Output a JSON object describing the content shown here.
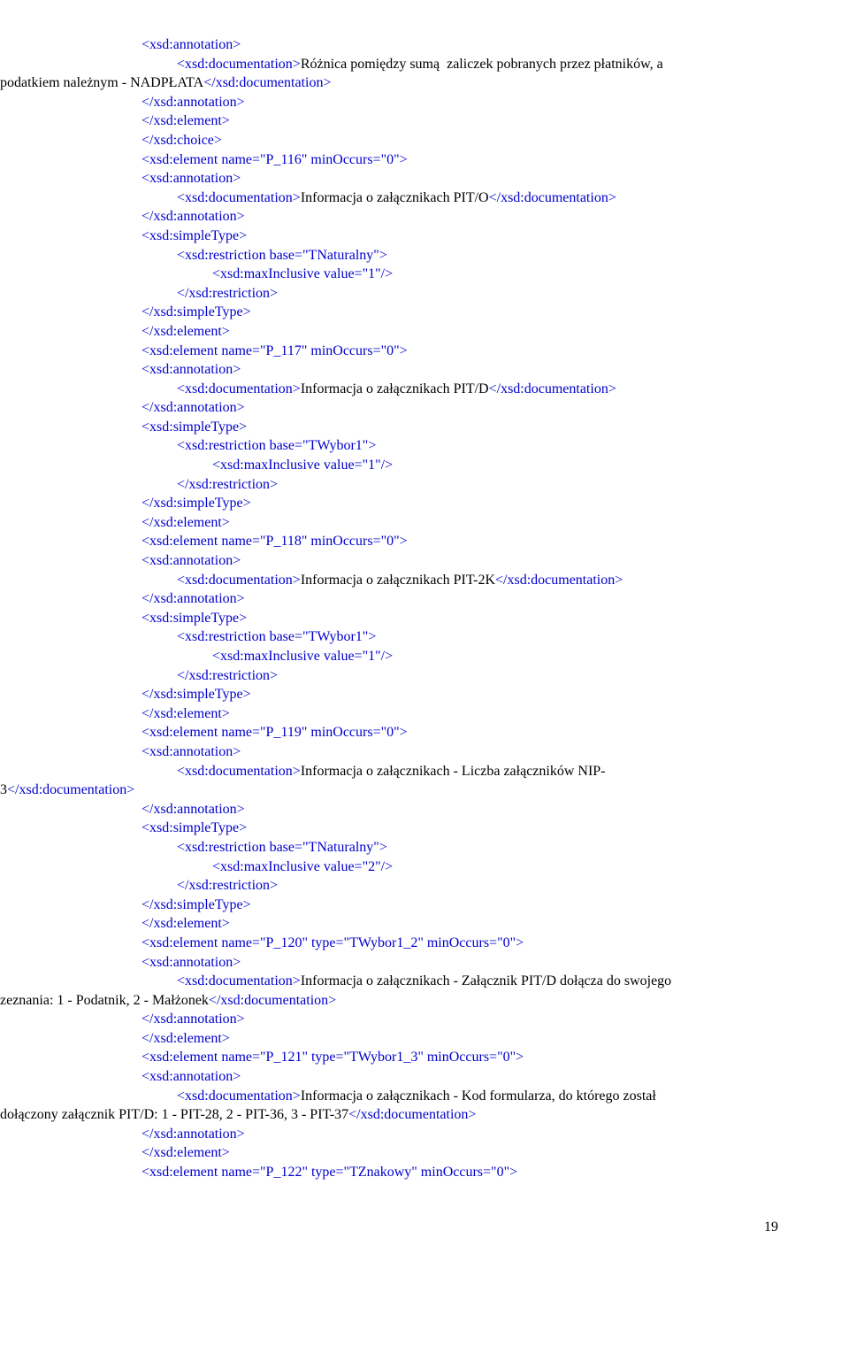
{
  "lines": [
    {
      "indent": "ind1",
      "parts": [
        {
          "c": "ltag",
          "t": "<xsd:annotation>"
        }
      ]
    },
    {
      "indent": "ind2",
      "parts": [
        {
          "c": "ltag",
          "t": "<xsd:documentation>"
        },
        {
          "c": "black",
          "t": "Różnica pomiędzy sumą  zaliczek pobranych przez płatników, a "
        }
      ]
    },
    {
      "indent": "ind0",
      "parts": [
        {
          "c": "black",
          "t": "podatkiem należnym - NADPŁATA"
        },
        {
          "c": "ltag",
          "t": "</xsd:documentation>"
        }
      ]
    },
    {
      "indent": "ind1",
      "parts": [
        {
          "c": "ltag",
          "t": "</xsd:annotation>"
        }
      ]
    },
    {
      "indent": "ind1",
      "parts": [
        {
          "c": "ltag",
          "t": "</xsd:element>"
        }
      ]
    },
    {
      "indent": "ind1",
      "parts": [
        {
          "c": "ltag",
          "t": "</xsd:choice>"
        }
      ]
    },
    {
      "indent": "ind1",
      "parts": [
        {
          "c": "ltag",
          "t": "<xsd:element name=\"P_116\" minOccurs=\"0\">"
        }
      ]
    },
    {
      "indent": "ind1",
      "parts": [
        {
          "c": "ltag",
          "t": "<xsd:annotation>"
        }
      ]
    },
    {
      "indent": "ind2",
      "parts": [
        {
          "c": "ltag",
          "t": "<xsd:documentation>"
        },
        {
          "c": "black",
          "t": "Informacja o załącznikach PIT/O"
        },
        {
          "c": "ltag",
          "t": "</xsd:documentation>"
        }
      ]
    },
    {
      "indent": "ind1",
      "parts": [
        {
          "c": "ltag",
          "t": "</xsd:annotation>"
        }
      ]
    },
    {
      "indent": "ind1",
      "parts": [
        {
          "c": "ltag",
          "t": "<xsd:simpleType>"
        }
      ]
    },
    {
      "indent": "ind2",
      "parts": [
        {
          "c": "ltag",
          "t": "<xsd:restriction base=\"TNaturalny\">"
        }
      ]
    },
    {
      "indent": "ind3",
      "parts": [
        {
          "c": "ltag",
          "t": "<xsd:maxInclusive value=\"1\"/>"
        }
      ]
    },
    {
      "indent": "ind2",
      "parts": [
        {
          "c": "ltag",
          "t": "</xsd:restriction>"
        }
      ]
    },
    {
      "indent": "ind1",
      "parts": [
        {
          "c": "ltag",
          "t": "</xsd:simpleType>"
        }
      ]
    },
    {
      "indent": "ind1",
      "parts": [
        {
          "c": "ltag",
          "t": "</xsd:element>"
        }
      ]
    },
    {
      "indent": "ind1",
      "parts": [
        {
          "c": "ltag",
          "t": "<xsd:element name=\"P_117\" minOccurs=\"0\">"
        }
      ]
    },
    {
      "indent": "ind1",
      "parts": [
        {
          "c": "ltag",
          "t": "<xsd:annotation>"
        }
      ]
    },
    {
      "indent": "ind2",
      "parts": [
        {
          "c": "ltag",
          "t": "<xsd:documentation>"
        },
        {
          "c": "black",
          "t": "Informacja o załącznikach PIT/D"
        },
        {
          "c": "ltag",
          "t": "</xsd:documentation>"
        }
      ]
    },
    {
      "indent": "ind1",
      "parts": [
        {
          "c": "ltag",
          "t": "</xsd:annotation>"
        }
      ]
    },
    {
      "indent": "ind1",
      "parts": [
        {
          "c": "ltag",
          "t": "<xsd:simpleType>"
        }
      ]
    },
    {
      "indent": "ind2",
      "parts": [
        {
          "c": "ltag",
          "t": "<xsd:restriction base=\"TWybor1\">"
        }
      ]
    },
    {
      "indent": "ind3",
      "parts": [
        {
          "c": "ltag",
          "t": "<xsd:maxInclusive value=\"1\"/>"
        }
      ]
    },
    {
      "indent": "ind2",
      "parts": [
        {
          "c": "ltag",
          "t": "</xsd:restriction>"
        }
      ]
    },
    {
      "indent": "ind1",
      "parts": [
        {
          "c": "ltag",
          "t": "</xsd:simpleType>"
        }
      ]
    },
    {
      "indent": "ind1",
      "parts": [
        {
          "c": "ltag",
          "t": "</xsd:element>"
        }
      ]
    },
    {
      "indent": "ind1",
      "parts": [
        {
          "c": "ltag",
          "t": "<xsd:element name=\"P_118\" minOccurs=\"0\">"
        }
      ]
    },
    {
      "indent": "ind1",
      "parts": [
        {
          "c": "ltag",
          "t": "<xsd:annotation>"
        }
      ]
    },
    {
      "indent": "ind2",
      "parts": [
        {
          "c": "ltag",
          "t": "<xsd:documentation>"
        },
        {
          "c": "black",
          "t": "Informacja o załącznikach PIT-2K"
        },
        {
          "c": "ltag",
          "t": "</xsd:documentation>"
        }
      ]
    },
    {
      "indent": "ind1",
      "parts": [
        {
          "c": "ltag",
          "t": "</xsd:annotation>"
        }
      ]
    },
    {
      "indent": "ind1",
      "parts": [
        {
          "c": "ltag",
          "t": "<xsd:simpleType>"
        }
      ]
    },
    {
      "indent": "ind2",
      "parts": [
        {
          "c": "ltag",
          "t": "<xsd:restriction base=\"TWybor1\">"
        }
      ]
    },
    {
      "indent": "ind3",
      "parts": [
        {
          "c": "ltag",
          "t": "<xsd:maxInclusive value=\"1\"/>"
        }
      ]
    },
    {
      "indent": "ind2",
      "parts": [
        {
          "c": "ltag",
          "t": "</xsd:restriction>"
        }
      ]
    },
    {
      "indent": "ind1",
      "parts": [
        {
          "c": "ltag",
          "t": "</xsd:simpleType>"
        }
      ]
    },
    {
      "indent": "ind1",
      "parts": [
        {
          "c": "ltag",
          "t": "</xsd:element>"
        }
      ]
    },
    {
      "indent": "ind1",
      "parts": [
        {
          "c": "ltag",
          "t": "<xsd:element name=\"P_119\" minOccurs=\"0\">"
        }
      ]
    },
    {
      "indent": "ind1",
      "parts": [
        {
          "c": "ltag",
          "t": "<xsd:annotation>"
        }
      ]
    },
    {
      "indent": "ind2",
      "parts": [
        {
          "c": "ltag",
          "t": "<xsd:documentation>"
        },
        {
          "c": "black",
          "t": "Informacja o załącznikach - Liczba załączników NIP-"
        }
      ]
    },
    {
      "indent": "ind0",
      "parts": [
        {
          "c": "black",
          "t": "3"
        },
        {
          "c": "ltag",
          "t": "</xsd:documentation>"
        }
      ]
    },
    {
      "indent": "ind1",
      "parts": [
        {
          "c": "ltag",
          "t": "</xsd:annotation>"
        }
      ]
    },
    {
      "indent": "ind1",
      "parts": [
        {
          "c": "ltag",
          "t": "<xsd:simpleType>"
        }
      ]
    },
    {
      "indent": "ind2",
      "parts": [
        {
          "c": "ltag",
          "t": "<xsd:restriction base=\"TNaturalny\">"
        }
      ]
    },
    {
      "indent": "ind3",
      "parts": [
        {
          "c": "ltag",
          "t": "<xsd:maxInclusive value=\"2\"/>"
        }
      ]
    },
    {
      "indent": "ind2",
      "parts": [
        {
          "c": "ltag",
          "t": "</xsd:restriction>"
        }
      ]
    },
    {
      "indent": "ind1",
      "parts": [
        {
          "c": "ltag",
          "t": "</xsd:simpleType>"
        }
      ]
    },
    {
      "indent": "ind1",
      "parts": [
        {
          "c": "ltag",
          "t": "</xsd:element>"
        }
      ]
    },
    {
      "indent": "ind1",
      "parts": [
        {
          "c": "ltag",
          "t": "<xsd:element name=\"P_120\" type=\"TWybor1_2\" minOccurs=\"0\">"
        }
      ]
    },
    {
      "indent": "ind1",
      "parts": [
        {
          "c": "ltag",
          "t": "<xsd:annotation>"
        }
      ]
    },
    {
      "indent": "ind2",
      "parts": [
        {
          "c": "ltag",
          "t": "<xsd:documentation>"
        },
        {
          "c": "black",
          "t": "Informacja o załącznikach - Załącznik PIT/D dołącza do swojego "
        }
      ]
    },
    {
      "indent": "ind0",
      "parts": [
        {
          "c": "black",
          "t": "zeznania: 1 - Podatnik, 2 - Małżonek"
        },
        {
          "c": "ltag",
          "t": "</xsd:documentation>"
        }
      ]
    },
    {
      "indent": "ind1",
      "parts": [
        {
          "c": "ltag",
          "t": "</xsd:annotation>"
        }
      ]
    },
    {
      "indent": "ind1",
      "parts": [
        {
          "c": "ltag",
          "t": "</xsd:element>"
        }
      ]
    },
    {
      "indent": "ind1",
      "parts": [
        {
          "c": "ltag",
          "t": "<xsd:element name=\"P_121\" type=\"TWybor1_3\" minOccurs=\"0\">"
        }
      ]
    },
    {
      "indent": "ind1",
      "parts": [
        {
          "c": "ltag",
          "t": "<xsd:annotation>"
        }
      ]
    },
    {
      "indent": "ind2",
      "parts": [
        {
          "c": "ltag",
          "t": "<xsd:documentation>"
        },
        {
          "c": "black",
          "t": "Informacja o załącznikach - Kod formularza, do którego został "
        }
      ]
    },
    {
      "indent": "ind0",
      "parts": [
        {
          "c": "black",
          "t": "dołączony załącznik PIT/D: 1 - PIT-28, 2 - PIT-36, 3 - PIT-37"
        },
        {
          "c": "ltag",
          "t": "</xsd:documentation>"
        }
      ]
    },
    {
      "indent": "ind1",
      "parts": [
        {
          "c": "ltag",
          "t": "</xsd:annotation>"
        }
      ]
    },
    {
      "indent": "ind1",
      "parts": [
        {
          "c": "ltag",
          "t": "</xsd:element>"
        }
      ]
    },
    {
      "indent": "ind1",
      "parts": [
        {
          "c": "ltag",
          "t": "<xsd:element name=\"P_122\" type=\"TZnakowy\" minOccurs=\"0\">"
        }
      ]
    }
  ],
  "page_number": "19"
}
